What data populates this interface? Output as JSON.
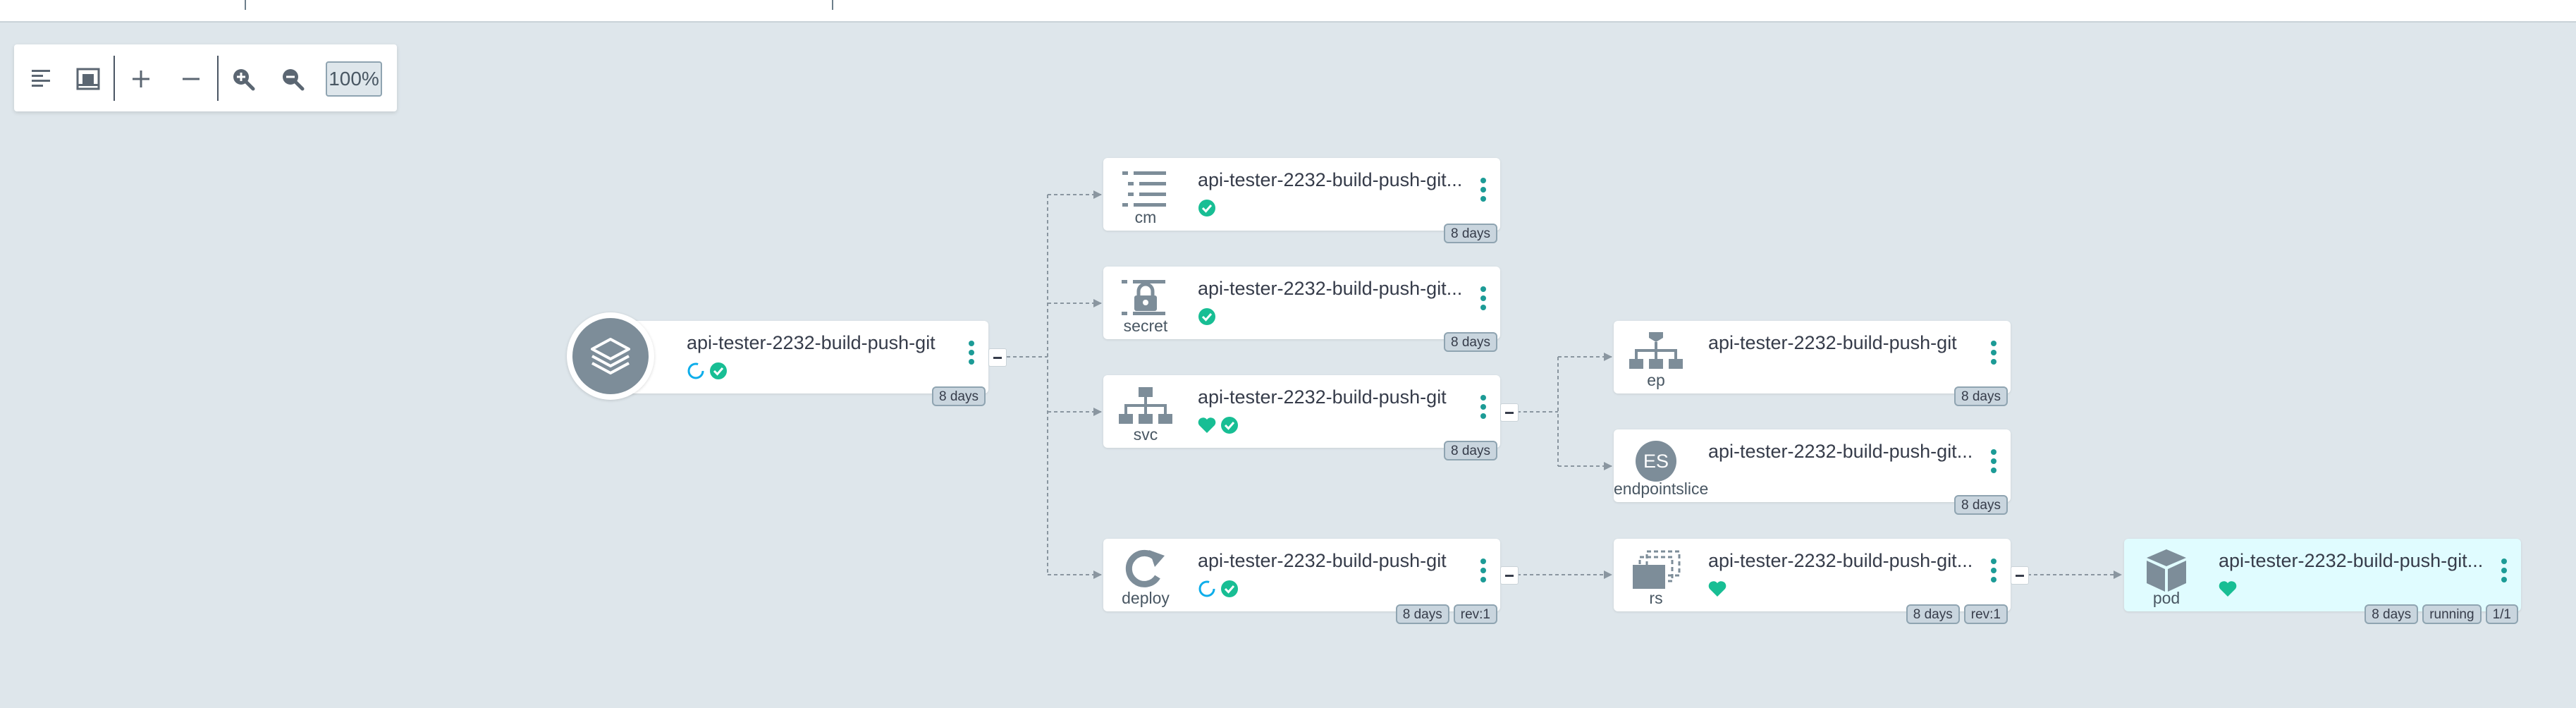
{
  "toolbar": {
    "buttons": [
      {
        "name": "align-left-icon",
        "label": "Layout"
      },
      {
        "name": "fit-to-screen-icon",
        "label": "Fit to screen"
      },
      {
        "name": "plus-icon",
        "label": "Expand all"
      },
      {
        "name": "minus-icon",
        "label": "Collapse all"
      },
      {
        "name": "zoom-in-icon",
        "label": "Zoom in"
      },
      {
        "name": "zoom-out-icon",
        "label": "Zoom out"
      }
    ],
    "zoom_level": "100%"
  },
  "colors": {
    "background": "#dee6eb",
    "node": "#ffffff",
    "pod_node": "#e0fcff",
    "healthy": "#18be94",
    "progressing": "#0dadea",
    "icon": "#7d8d99"
  },
  "app": {
    "title": "api-tester-2232-build-push-git",
    "status_icons": [
      "progressing-icon",
      "synced-check-icon"
    ],
    "tags": [
      "8 days"
    ]
  },
  "nodes": {
    "cm": {
      "kind": "cm",
      "title": "api-tester-2232-build-push-git...",
      "status_icons": [
        "synced-check-icon"
      ],
      "tags": [
        "8 days"
      ]
    },
    "secret": {
      "kind": "secret",
      "title": "api-tester-2232-build-push-git...",
      "status_icons": [
        "synced-check-icon"
      ],
      "tags": [
        "8 days"
      ]
    },
    "svc": {
      "kind": "svc",
      "title": "api-tester-2232-build-push-git",
      "status_icons": [
        "healthy-heart-icon",
        "synced-check-icon"
      ],
      "tags": [
        "8 days"
      ]
    },
    "deploy": {
      "kind": "deploy",
      "title": "api-tester-2232-build-push-git",
      "status_icons": [
        "progressing-icon",
        "synced-check-icon"
      ],
      "tags": [
        "8 days",
        "rev:1"
      ]
    },
    "ep": {
      "kind": "ep",
      "title": "api-tester-2232-build-push-git",
      "status_icons": [],
      "tags": [
        "8 days"
      ]
    },
    "endpointslice": {
      "kind": "endpointslice",
      "badge": "ES",
      "title": "api-tester-2232-build-push-git...",
      "status_icons": [],
      "tags": [
        "8 days"
      ]
    },
    "rs": {
      "kind": "rs",
      "title": "api-tester-2232-build-push-git...",
      "status_icons": [
        "healthy-heart-icon"
      ],
      "tags": [
        "8 days",
        "rev:1"
      ]
    },
    "pod": {
      "kind": "pod",
      "title": "api-tester-2232-build-push-git...",
      "status_icons": [
        "healthy-heart-icon"
      ],
      "tags": [
        "8 days",
        "running",
        "1/1"
      ]
    }
  }
}
